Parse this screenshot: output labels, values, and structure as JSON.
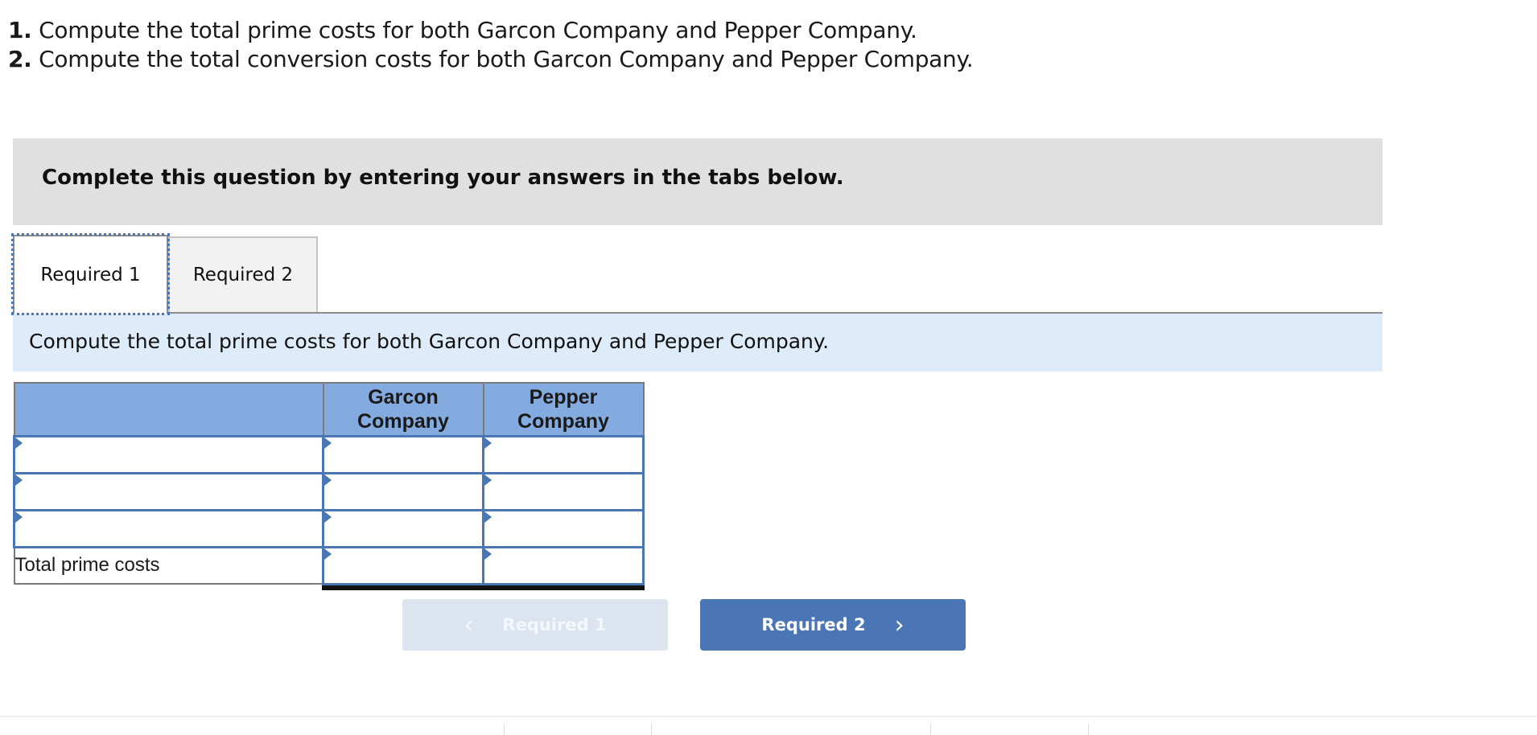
{
  "questions": [
    {
      "number": "1.",
      "text": " Compute the total prime costs for both Garcon Company and Pepper Company."
    },
    {
      "number": "2.",
      "text": " Compute the total conversion costs for both Garcon Company and Pepper Company."
    }
  ],
  "instruction": "Complete this question by entering your answers in the tabs below.",
  "tabs": [
    {
      "label": "Required 1",
      "active": true
    },
    {
      "label": "Required 2",
      "active": false
    }
  ],
  "subheading": "Compute the total prime costs for both Garcon Company and Pepper Company.",
  "table": {
    "headers": [
      "",
      "Garcon Company",
      "Pepper Company"
    ],
    "rows": [
      {
        "label": "",
        "garcon": "",
        "pepper": ""
      },
      {
        "label": "",
        "garcon": "",
        "pepper": ""
      },
      {
        "label": "",
        "garcon": "",
        "pepper": ""
      }
    ],
    "total_row": {
      "label": "Total prime costs",
      "garcon": "",
      "pepper": ""
    }
  },
  "nav": {
    "prev_label": "Required 1",
    "next_label": "Required 2",
    "prev_icon": "chevron-left-icon",
    "next_icon": "chevron-right-icon",
    "prev_enabled": false
  },
  "colors": {
    "accent": "#4a76b5",
    "header_bg": "#84abdf",
    "subhead_bg": "#deebf8",
    "instruction_bg": "#e0e0e0"
  }
}
